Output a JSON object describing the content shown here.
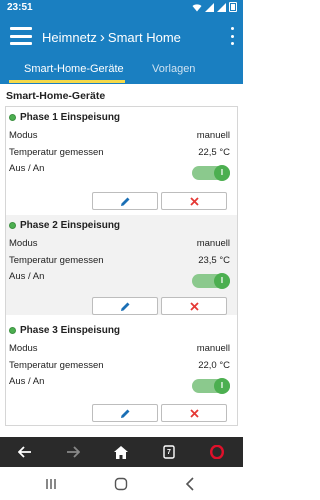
{
  "status": {
    "time": "23:51"
  },
  "appbar": {
    "crumb_parent": "Heimnetz",
    "crumb_separator": "›",
    "crumb_current": "Smart Home"
  },
  "tabs": [
    {
      "label": "Smart-Home-Geräte",
      "active": true
    },
    {
      "label": "Vorlagen",
      "active": false
    }
  ],
  "section_title": "Smart-Home-Geräte",
  "devices": [
    {
      "name": "Phase 1 Einspeisung",
      "mode_label": "Modus",
      "mode_value": "manuell",
      "temp_label": "Temperatur gemessen",
      "temp_value": "22,5 °C",
      "switch_label": "Aus / An",
      "switch_state": "I"
    },
    {
      "name": "Phase 2 Einspeisung",
      "mode_label": "Modus",
      "mode_value": "manuell",
      "temp_label": "Temperatur gemessen",
      "temp_value": "23,5 °C",
      "switch_label": "Aus / An",
      "switch_state": "I"
    },
    {
      "name": "Phase 3 Einspeisung",
      "mode_label": "Modus",
      "mode_value": "manuell",
      "temp_label": "Temperatur gemessen",
      "temp_value": "22,0 °C",
      "switch_label": "Aus / An",
      "switch_state": "I"
    }
  ],
  "browser_nav": {
    "tab_count": "7"
  },
  "colors": {
    "primary": "#1a7fc1",
    "tab_indicator": "#f5d949",
    "on_green": "#4caf50",
    "delete_red": "#e53935",
    "edit_blue": "#1a6fb5",
    "opera_red": "#e0102a"
  }
}
